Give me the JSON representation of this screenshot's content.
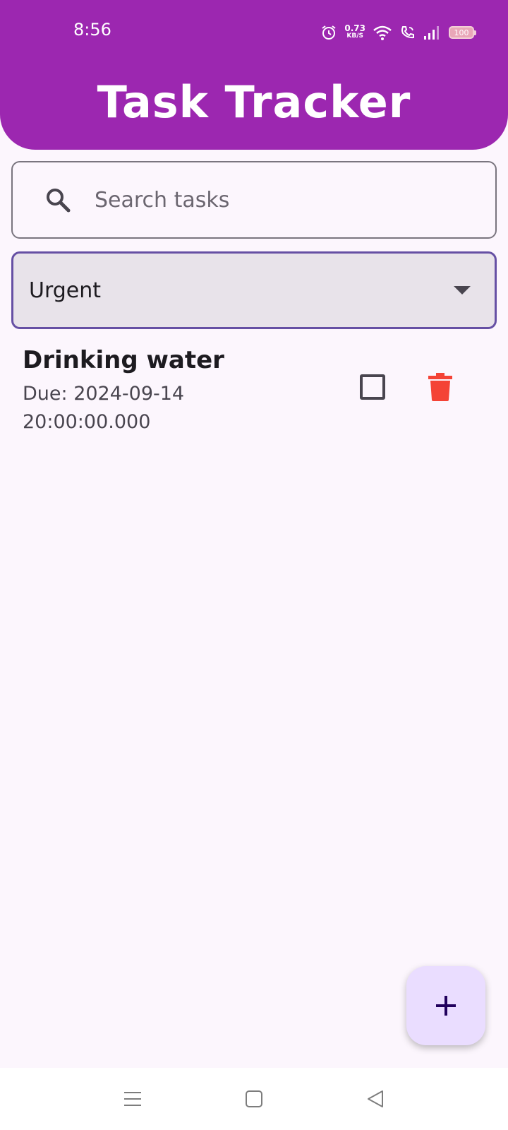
{
  "status_bar": {
    "time": "8:56",
    "net_speed_value": "0.73",
    "net_speed_unit": "KB/S",
    "battery": "100",
    "icons": [
      "alarm-icon",
      "wifi-icon",
      "wifi-calling-icon",
      "signal-icon",
      "battery-icon"
    ]
  },
  "app_bar": {
    "title": "Task Tracker",
    "color": "#9c27b0"
  },
  "search": {
    "placeholder": "Search tasks",
    "value": "",
    "icon": "search-icon"
  },
  "filter": {
    "selected": "Urgent",
    "icon": "dropdown-arrow-icon",
    "border_color": "#6650a4"
  },
  "tasks": [
    {
      "title": "Drinking water",
      "due": "Due: 2024-09-14 20:00:00.000",
      "completed": false,
      "delete_color": "#f44336"
    }
  ],
  "fab": {
    "icon": "add-icon",
    "color": "#eaddff"
  },
  "nav_bar": {
    "items": [
      "menu-icon",
      "home-icon",
      "back-icon"
    ]
  }
}
